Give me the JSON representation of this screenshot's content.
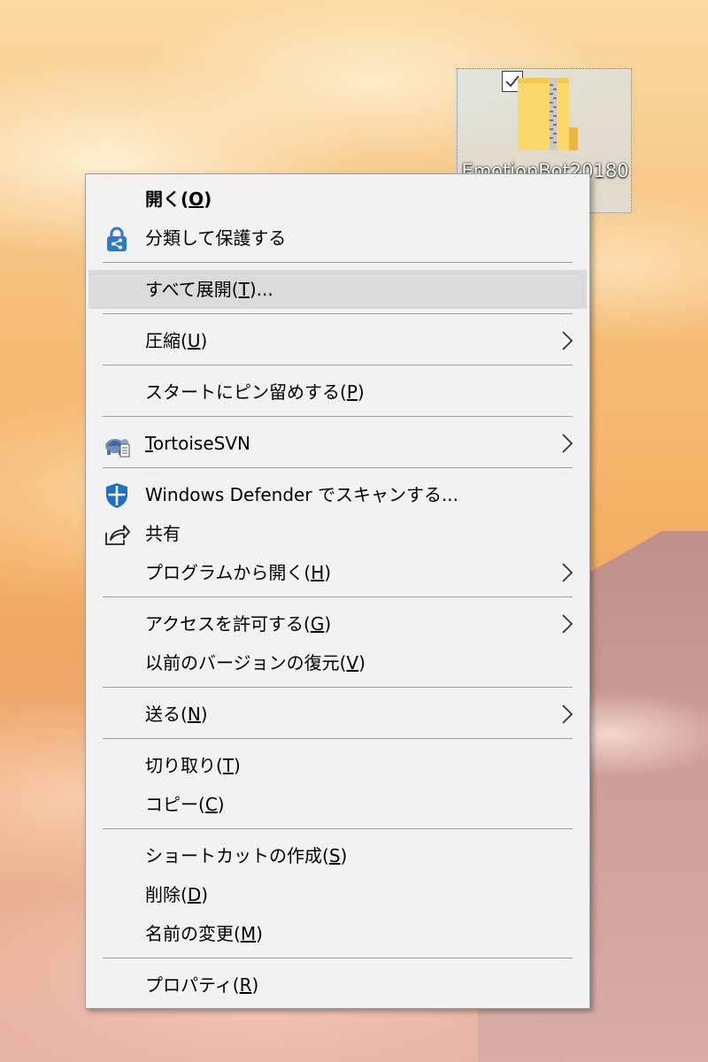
{
  "desktop": {
    "file_label": "EmotionBot20180",
    "checked": true
  },
  "menu": {
    "open": {
      "text": "開く(",
      "key": "O",
      "tail": ")"
    },
    "classify": {
      "text": "分類して保護する"
    },
    "extract_all": {
      "text": "すべて展開(",
      "key": "T",
      "tail": ")..."
    },
    "compress": {
      "text": "圧縮(",
      "key": "U",
      "tail": ")"
    },
    "pin_start": {
      "text": "スタートにピン留めする(",
      "key": "P",
      "tail": ")"
    },
    "tortoise": {
      "key": "T",
      "text": "ortoiseSVN"
    },
    "defender": {
      "text": "Windows Defender でスキャンする..."
    },
    "share": {
      "text": "共有"
    },
    "open_with": {
      "text": "プログラムから開く(",
      "key": "H",
      "tail": ")"
    },
    "give_access": {
      "text": "アクセスを許可する(",
      "key": "G",
      "tail": ")"
    },
    "restore": {
      "text": "以前のバージョンの復元(",
      "key": "V",
      "tail": ")"
    },
    "send_to": {
      "text": "送る(",
      "key": "N",
      "tail": ")"
    },
    "cut": {
      "text": "切り取り(",
      "key": "T",
      "tail": ")"
    },
    "copy": {
      "text": "コピー(",
      "key": "C",
      "tail": ")"
    },
    "shortcut": {
      "text": "ショートカットの作成(",
      "key": "S",
      "tail": ")"
    },
    "delete": {
      "text": "削除(",
      "key": "D",
      "tail": ")"
    },
    "rename": {
      "text": "名前の変更(",
      "key": "M",
      "tail": ")"
    },
    "properties": {
      "text": "プロパティ(",
      "key": "R",
      "tail": ")"
    }
  },
  "icons": {
    "classify": "lock-share-icon",
    "tortoise": "tortoise-svn-icon",
    "defender": "shield-icon",
    "share": "share-icon",
    "submenu": "chevron-right-icon"
  },
  "colors": {
    "menu_bg": "#f2f2f2",
    "hover_bg": "#dadada",
    "accent_blue": "#2b79d0"
  }
}
